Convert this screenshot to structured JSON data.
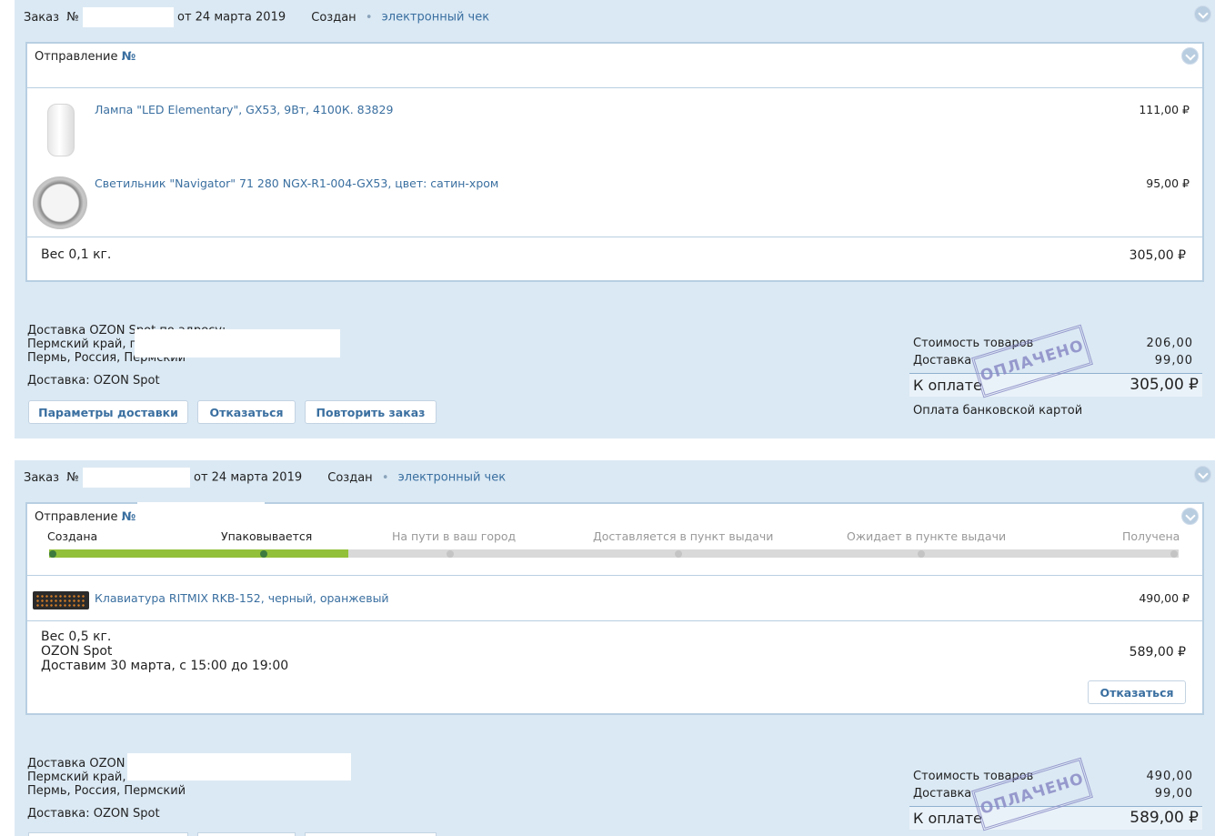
{
  "orders": [
    {
      "label": "Заказ",
      "no_sign": "№",
      "date": "от 24 марта 2019",
      "status": "Создан",
      "receipt": "электронный чек",
      "shipment": {
        "title": "Отправление",
        "no_sign": "№",
        "items": [
          {
            "name": "Лампа \"LED Elementary\", GX53, 9Вт, 4100К. 83829",
            "price": "111,00 ₽",
            "image": "lamp-image"
          },
          {
            "name": "Светильник \"Navigator\" 71 280 NGX-R1-004-GX53, цвет: сатин-хром",
            "price": "95,00 ₽",
            "image": "fixture-image"
          }
        ],
        "weight": "Вес 0,1 кг.",
        "total": "305,00 ₽"
      },
      "address": [
        "Доставка OZON Spot по адресу:",
        "Пермский край, г",
        "Пермь, Россия, Пермский"
      ],
      "delivery": "Доставка: OZON Spot",
      "buttons": [
        "Параметры доставки",
        "Отказаться",
        "Повторить заказ"
      ],
      "summary": {
        "goods_label": "Стоимость товаров",
        "goods_value": "206,00",
        "delivery_label": "Доставка",
        "delivery_value": "99,00",
        "pay_label": "К оплате",
        "pay_value": "305,00 ₽",
        "method": "Оплата банковской картой",
        "stamp": "ОПЛАЧЕНО"
      }
    },
    {
      "label": "Заказ",
      "no_sign": "№",
      "date": "от 24 марта 2019",
      "status": "Создан",
      "receipt": "электронный чек",
      "shipment": {
        "title": "Отправление",
        "no_sign": "№",
        "progress": {
          "steps": [
            "Создана",
            "Упаковывается",
            "На пути в ваш город",
            "Доставляется в пункт выдачи",
            "Ожидает в пункте выдачи",
            "Получена"
          ],
          "completed_fraction": 0.265,
          "done_count": 2
        },
        "items": [
          {
            "name": "Клавиатура RITMIX RKB-152, черный, оранжевый",
            "price": "490,00 ₽",
            "image": "keyboard-image"
          }
        ],
        "weight": "Вес 0,5 кг.",
        "service": "OZON Spot",
        "eta": "Доставим 30 марта, с 15:00 до 19:00",
        "total": "589,00 ₽",
        "cancel": "Отказаться"
      },
      "address": [
        "Доставка OZON S",
        "Пермский край,",
        "Пермь, Россия, Пермский"
      ],
      "delivery": "Доставка: OZON Spot",
      "summary": {
        "goods_label": "Стоимость товаров",
        "goods_value": "490,00",
        "delivery_label": "Доставка",
        "delivery_value": "99,00",
        "pay_label": "К оплате",
        "pay_value": "589,00 ₽",
        "stamp": "ОПЛАЧЕНО"
      }
    }
  ],
  "colors": {
    "panel": "#dbe9f4",
    "link": "#3a6fa0",
    "progress_done": "#93c03a",
    "progress_todo": "#d9d9d9",
    "stamp": "#8b8cc6"
  }
}
